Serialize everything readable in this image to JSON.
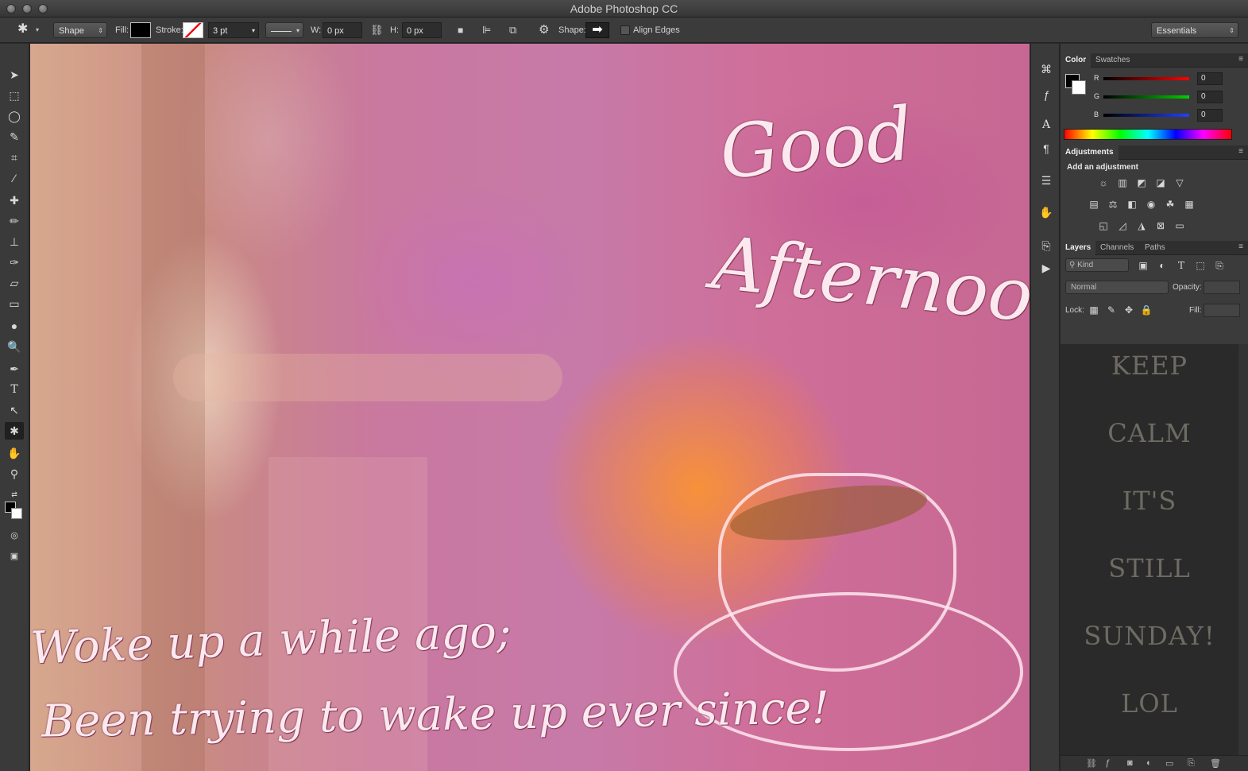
{
  "window": {
    "title": "Adobe Photoshop CC"
  },
  "options_bar": {
    "tool_mode": "Shape",
    "fill_label": "Fill:",
    "stroke_label": "Stroke:",
    "stroke_width": "3 pt",
    "w_label": "W:",
    "w_value": "0 px",
    "h_label": "H:",
    "h_value": "0 px",
    "shape_label": "Shape:",
    "align_edges_label": "Align Edges",
    "workspace": "Essentials"
  },
  "tools": [
    "move-tool-icon",
    "marquee-tool-icon",
    "lasso-tool-icon",
    "quick-select-tool-icon",
    "crop-tool-icon",
    "eyedropper-tool-icon",
    "healing-brush-tool-icon",
    "brush-tool-icon",
    "clone-stamp-tool-icon",
    "history-brush-tool-icon",
    "eraser-tool-icon",
    "gradient-tool-icon",
    "blur-tool-icon",
    "dodge-tool-icon",
    "pen-tool-icon",
    "type-tool-icon",
    "path-selection-tool-icon",
    "custom-shape-tool-icon",
    "hand-tool-icon",
    "zoom-tool-icon"
  ],
  "canvas": {
    "title_line1": "Good",
    "title_line2": "Afternoon!",
    "bottom_line1": "Woke up a while ago;",
    "bottom_line2": "Been trying to wake up ever since!"
  },
  "color_panel": {
    "tab_color": "Color",
    "tab_swatches": "Swatches",
    "r_label": "R",
    "r_value": "0",
    "g_label": "G",
    "g_value": "0",
    "b_label": "B",
    "b_value": "0"
  },
  "adjustments_panel": {
    "tab": "Adjustments",
    "heading": "Add an adjustment"
  },
  "layers_panel": {
    "tab_layers": "Layers",
    "tab_channels": "Channels",
    "tab_paths": "Paths",
    "filter_kind": "Kind",
    "blend_mode": "Normal",
    "opacity_label": "Opacity:",
    "lock_label": "Lock:",
    "fill_label": "Fill:",
    "thumbnail_lines": [
      "KEEP",
      "CALM",
      "IT'S",
      "STILL",
      "SUNDAY!",
      "LOL"
    ]
  }
}
